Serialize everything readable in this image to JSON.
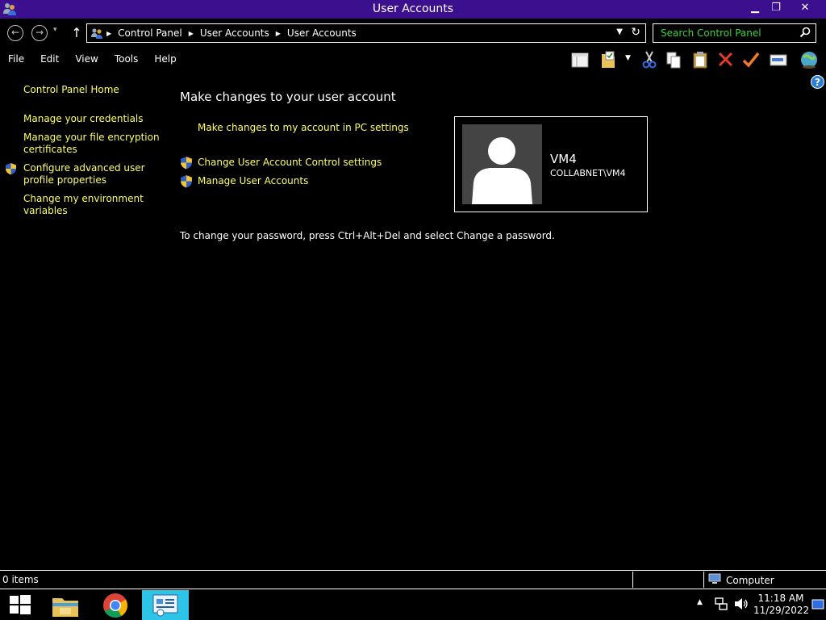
{
  "window": {
    "title": "User Accounts",
    "controls": {
      "minimize": "▁",
      "restore": "❐",
      "close": "✕"
    }
  },
  "nav": {
    "back": "←",
    "forward": "→",
    "dropdown": "▾",
    "up": "↑",
    "breadcrumbs": [
      "Control Panel",
      "User Accounts",
      "User Accounts"
    ],
    "search_placeholder": "Search Control Panel"
  },
  "menu": [
    "File",
    "Edit",
    "View",
    "Tools",
    "Help"
  ],
  "toolbar_icons": [
    "layout-icon",
    "folder-options-icon",
    "cut-icon",
    "copy-icon",
    "paste-icon",
    "delete-icon",
    "check-icon",
    "properties-icon",
    "globe-icon"
  ],
  "left_pane": {
    "home": "Control Panel Home",
    "links": [
      {
        "label_1": "Manage your credentials",
        "label_2": ""
      },
      {
        "label_1": "Manage your file encryption",
        "label_2": "certificates"
      },
      {
        "label_1": "Configure advanced user",
        "label_2": "profile properties"
      },
      {
        "label_1": "Change my environment",
        "label_2": "variables"
      }
    ]
  },
  "main": {
    "heading": "Make changes to your user account",
    "links": [
      "Make changes to my account in PC settings",
      "Change User Account Control settings",
      "Manage User Accounts"
    ],
    "password_note": "To change your password, press Ctrl+Alt+Del and select Change a password."
  },
  "user": {
    "name": "VM4",
    "domain": "COLLABNET\\VM4"
  },
  "status": {
    "items": "0 items",
    "zone": "Computer"
  },
  "taskbar": {
    "time": "11:18 AM",
    "date": "11/29/2022"
  },
  "colors": {
    "titlebar": "#3b0f8e",
    "link": "#ffff66",
    "search_text": "#3fd13f",
    "active_task": "#2ec4e8"
  }
}
